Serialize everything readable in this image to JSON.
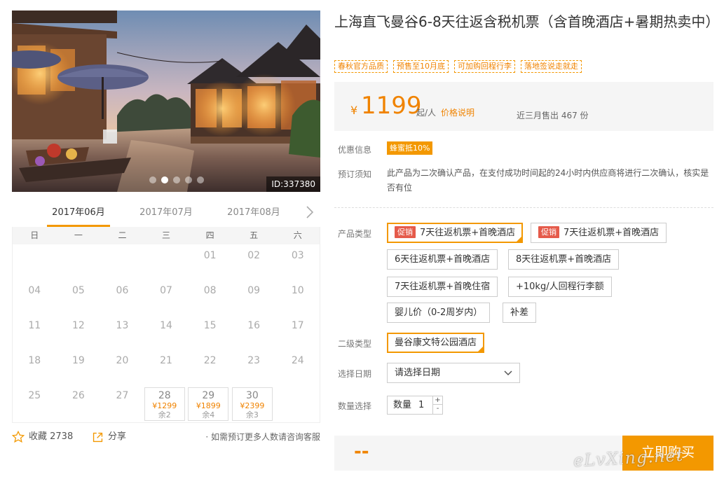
{
  "hero": {
    "id_text": "ID:337380",
    "dots": 5,
    "active_dot": 1
  },
  "calendar": {
    "months": [
      "2017年06月",
      "2017年07月",
      "2017年08月"
    ],
    "weekdays": [
      "日",
      "一",
      "二",
      "三",
      "四",
      "五",
      "六"
    ],
    "weeks": [
      [
        {
          "d": ""
        },
        {
          "d": ""
        },
        {
          "d": ""
        },
        {
          "d": ""
        },
        {
          "d": "01"
        },
        {
          "d": "02"
        },
        {
          "d": "03"
        }
      ],
      [
        {
          "d": "04"
        },
        {
          "d": "05"
        },
        {
          "d": "06"
        },
        {
          "d": "07"
        },
        {
          "d": "08"
        },
        {
          "d": "09"
        },
        {
          "d": "10"
        }
      ],
      [
        {
          "d": "11"
        },
        {
          "d": "12"
        },
        {
          "d": "13"
        },
        {
          "d": "14"
        },
        {
          "d": "15"
        },
        {
          "d": "16"
        },
        {
          "d": "17"
        }
      ],
      [
        {
          "d": "18"
        },
        {
          "d": "19"
        },
        {
          "d": "20"
        },
        {
          "d": "21"
        },
        {
          "d": "22"
        },
        {
          "d": "23"
        },
        {
          "d": "24"
        }
      ],
      [
        {
          "d": "25"
        },
        {
          "d": "26"
        },
        {
          "d": "27"
        },
        {
          "d": "28",
          "price": "¥1299",
          "remain": "余2"
        },
        {
          "d": "29",
          "price": "¥1899",
          "remain": "余4"
        },
        {
          "d": "30",
          "price": "¥2399",
          "remain": "余3"
        },
        {
          "d": ""
        }
      ]
    ]
  },
  "footer_left": {
    "favorite_label": "收藏 2738",
    "share_label": "分享",
    "note": "· 如需预订更多人数请咨询客服"
  },
  "product": {
    "title": "上海直飞曼谷6-8天往返含税机票（含首晚酒店+暑期热卖中）",
    "tags": [
      "春秋官方品质",
      "预售至10月底",
      "可加购回程行李",
      "落地签说走就走"
    ],
    "price": {
      "currency": "¥",
      "amount": "1199",
      "unit": "起/人",
      "note": "价格说明",
      "sold": "近三月售出 467 份"
    },
    "discount_label": "优惠信息",
    "discount_badge": "蜂蜜抵10%",
    "notice_label": "预订须知",
    "notice_text": "此产品为二次确认产品，在支付成功时间起的24小时内供应商将进行二次确认，核实是否有位",
    "type_label": "产品类型",
    "types": [
      {
        "promo": "促销",
        "label": "7天往返机票+首晚酒店",
        "selected": true
      },
      {
        "promo": "促销",
        "label": "7天往返机票+首晚酒店",
        "selected": false
      },
      {
        "promo": "",
        "label": "6天往返机票+首晚酒店",
        "selected": false
      },
      {
        "promo": "",
        "label": "8天往返机票+首晚酒店",
        "selected": false
      },
      {
        "promo": "",
        "label": "7天往返机票+首晚住宿",
        "selected": false
      },
      {
        "promo": "",
        "label": "+10kg/人回程行李额",
        "selected": false
      },
      {
        "promo": "",
        "label": "婴儿价（0-2周岁内）",
        "selected": false
      },
      {
        "promo": "",
        "label": "补差",
        "selected": false
      }
    ],
    "subtype_label": "二级类型",
    "subtype": "曼谷康文特公园酒店",
    "date_label": "选择日期",
    "date_placeholder": "请选择日期",
    "qty_label": "数量选择",
    "qty_inner_label": "数量",
    "qty_value": "1",
    "qty_plus": "+",
    "qty_minus": "-",
    "total_placeholder": "--",
    "buy_label": "立即购买"
  },
  "watermark": "eLvXing.net",
  "colors": {
    "accent": "#f39800",
    "accent_text": "#f08300",
    "promo_red": "#e55a4a",
    "panel_bg": "#f5f5f5"
  }
}
